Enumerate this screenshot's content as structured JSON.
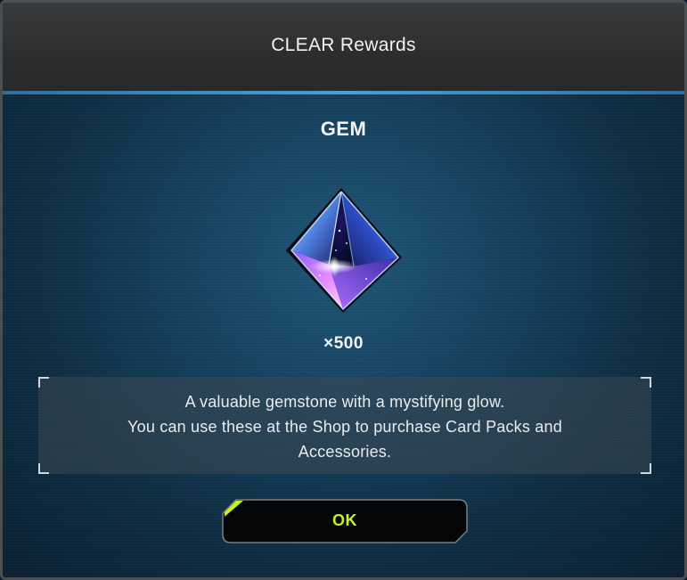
{
  "dialog": {
    "title": "CLEAR Rewards"
  },
  "reward": {
    "name": "GEM",
    "icon": "gem-icon",
    "quantity": "×500",
    "description_lines": [
      "A valuable gemstone with a mystifying glow.",
      "You can use these at the Shop to purchase Card Packs and",
      "Accessories."
    ]
  },
  "actions": {
    "ok_label": "OK"
  },
  "colors": {
    "accent_line": "#4aa0d8",
    "button_text": "#c8f21e",
    "button_bg": "#000000"
  }
}
